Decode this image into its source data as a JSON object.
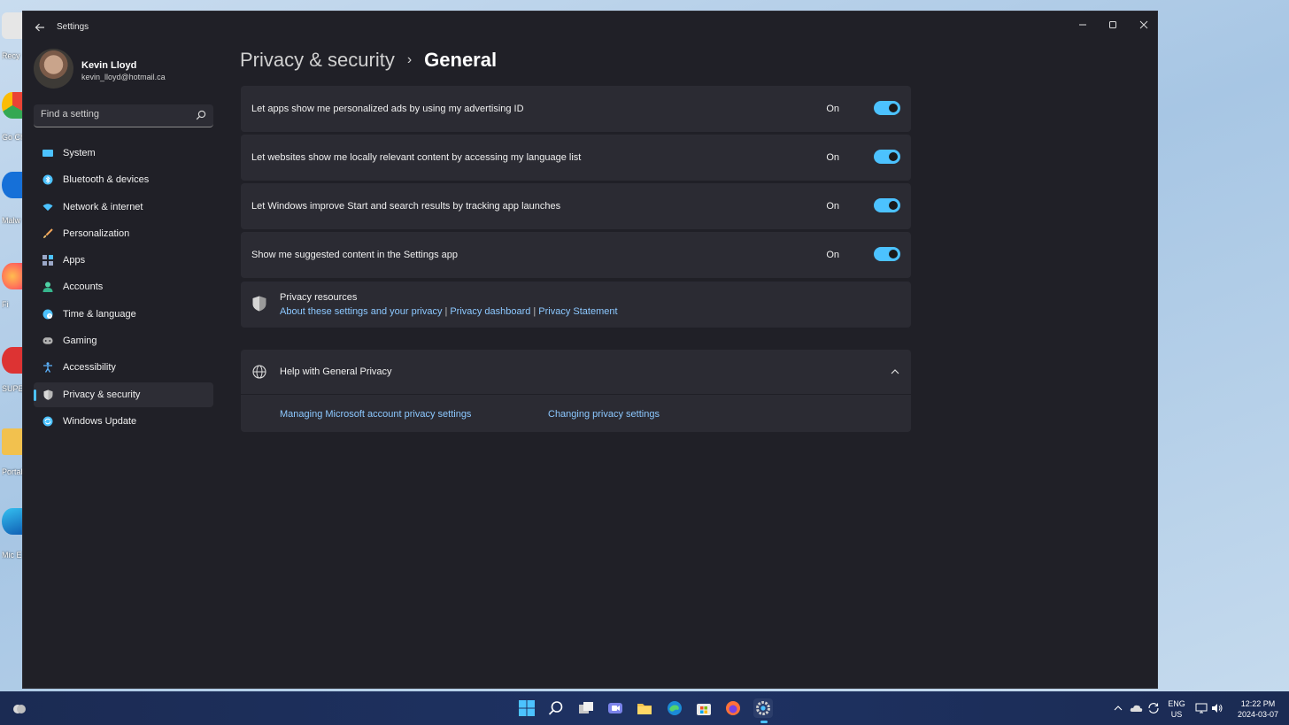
{
  "desktop": {
    "icons": [
      "Recy",
      "Go Chi",
      "Malw",
      "Fi",
      "SUPE Free",
      "Portal",
      "Mic E"
    ]
  },
  "window": {
    "title": "Settings",
    "controls": [
      "minimize-icon",
      "maximize-icon",
      "close-icon"
    ]
  },
  "profile": {
    "name": "Kevin Lloyd",
    "email": "kevin_lloyd@hotmail.ca"
  },
  "search": {
    "placeholder": "Find a setting"
  },
  "nav": {
    "items": [
      {
        "label": "System",
        "icon": "system-icon",
        "color": "#4cc2ff"
      },
      {
        "label": "Bluetooth & devices",
        "icon": "bluetooth-icon",
        "color": "#4cc2ff"
      },
      {
        "label": "Network & internet",
        "icon": "wifi-icon",
        "color": "#4cc2ff"
      },
      {
        "label": "Personalization",
        "icon": "brush-icon",
        "color": "#f2a65a"
      },
      {
        "label": "Apps",
        "icon": "apps-icon",
        "color": "#9aa7c7"
      },
      {
        "label": "Accounts",
        "icon": "person-icon",
        "color": "#4fd1a5"
      },
      {
        "label": "Time & language",
        "icon": "globe-clock-icon",
        "color": "#4cc2ff"
      },
      {
        "label": "Gaming",
        "icon": "gamepad-icon",
        "color": "#b0b0b0"
      },
      {
        "label": "Accessibility",
        "icon": "accessibility-icon",
        "color": "#5cb3ff"
      },
      {
        "label": "Privacy & security",
        "icon": "shield-icon",
        "color": "#b7b7b7",
        "active": true
      },
      {
        "label": "Windows Update",
        "icon": "refresh-icon",
        "color": "#4cc2ff"
      }
    ]
  },
  "breadcrumb": {
    "parent": "Privacy & security",
    "separator": "›",
    "current": "General"
  },
  "settings": [
    {
      "label": "Let apps show me personalized ads by using my advertising ID",
      "state": "On"
    },
    {
      "label": "Let websites show me locally relevant content by accessing my language list",
      "state": "On"
    },
    {
      "label": "Let Windows improve Start and search results by tracking app launches",
      "state": "On"
    },
    {
      "label": "Show me suggested content in the Settings app",
      "state": "On"
    }
  ],
  "resources": {
    "title": "Privacy resources",
    "links": [
      "About these settings and your privacy",
      "Privacy dashboard",
      "Privacy Statement"
    ],
    "separator": "|"
  },
  "help": {
    "title": "Help with General Privacy",
    "links": [
      "Managing Microsoft account privacy settings",
      "Changing privacy settings"
    ]
  },
  "taskbar": {
    "apps": [
      "start-icon",
      "search-icon",
      "task-view-icon",
      "chat-icon",
      "file-explorer-icon",
      "edge-icon",
      "store-icon",
      "firefox-icon",
      "settings-icon"
    ],
    "lang_top": "ENG",
    "lang_bottom": "US",
    "time": "12:22 PM",
    "date": "2024-03-07"
  },
  "colors": {
    "accent": "#4cc2ff",
    "link": "#8cc8ff",
    "window_bg": "#202027",
    "card_bg": "#2b2b33"
  }
}
